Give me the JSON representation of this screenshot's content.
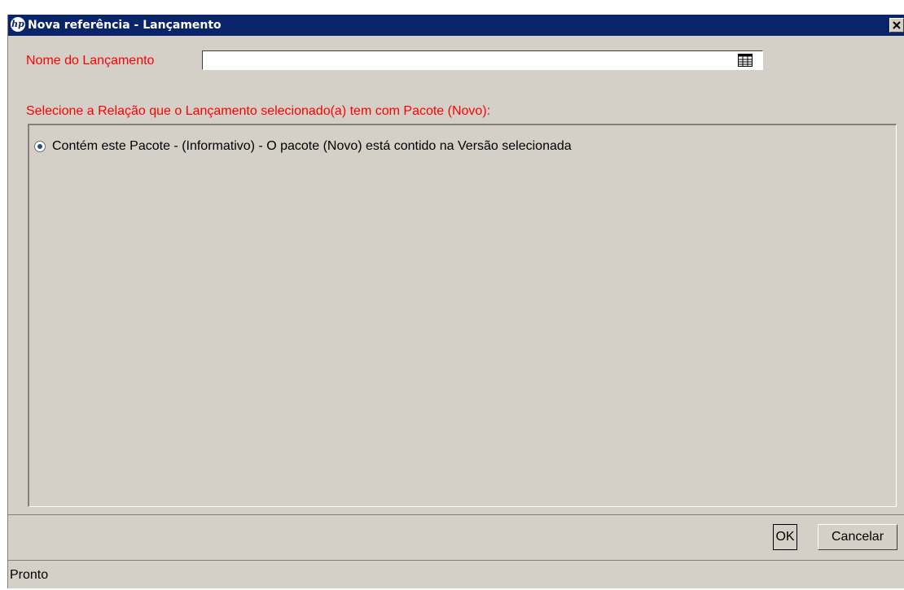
{
  "window": {
    "title": "Nova referência - Lançamento",
    "logo_text": "hp"
  },
  "form": {
    "name_label": "Nome do Lançamento",
    "name_value": "",
    "relation_label": "Selecione a Relação que o Lançamento selecionado(a) tem com Pacote (Novo):"
  },
  "options": [
    {
      "label": "Contém este Pacote - (Informativo) - O pacote (Novo) está contido na Versão selecionada",
      "selected": true
    }
  ],
  "buttons": {
    "ok_label": "OK",
    "cancel_label": "Cancelar"
  },
  "status": {
    "text": "Pronto"
  },
  "colors": {
    "titlebar": "#0a246a",
    "window_bg": "#d4d0c8",
    "required_label": "#ff0000"
  },
  "icons": {
    "title_logo": "hp-logo-icon",
    "close": "close-icon",
    "lookup": "table-lookup-icon"
  }
}
